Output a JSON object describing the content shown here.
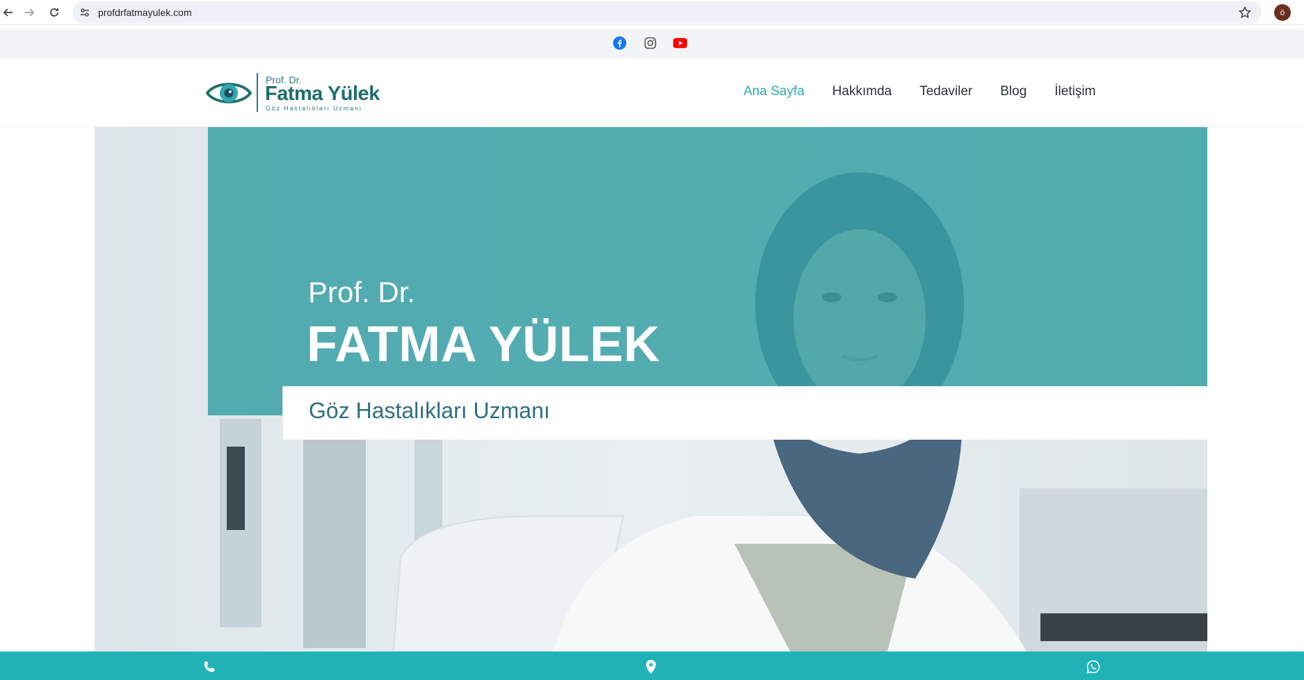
{
  "browser": {
    "url": "profdrfatmayulek.com",
    "profile_initial": "ö"
  },
  "social": {
    "icons": [
      "facebook-icon",
      "instagram-icon",
      "youtube-icon"
    ],
    "colors": {
      "facebook": "#1877f2",
      "instagram": "#555555",
      "youtube": "#ff0000"
    }
  },
  "header": {
    "logo": {
      "prefix": "Prof. Dr.",
      "name": "Fatma Yülek",
      "subtitle": "Göz Hastalıkları Uzmanı"
    },
    "nav": [
      {
        "label": "Ana Sayfa",
        "active": true
      },
      {
        "label": "Hakkımda",
        "active": false
      },
      {
        "label": "Tedaviler",
        "active": false
      },
      {
        "label": "Blog",
        "active": false
      },
      {
        "label": "İletişim",
        "active": false
      }
    ],
    "accent_color": "#2fa8b0"
  },
  "hero": {
    "prefix": "Prof. Dr.",
    "name": "FATMA YÜLEK",
    "specialty": "Göz Hastalıkları Uzmanı",
    "panel_color": "#37a0a5"
  },
  "contact_bar": {
    "color": "#1fb3b8",
    "icons": [
      "phone-icon",
      "location-pin-icon",
      "whatsapp-icon"
    ]
  }
}
